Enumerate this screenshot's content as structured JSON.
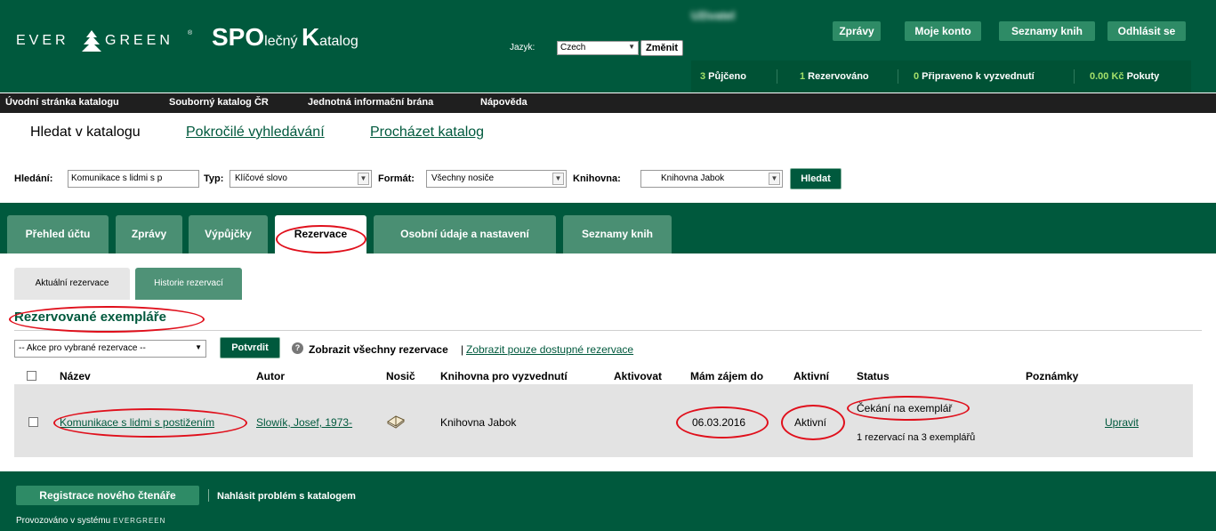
{
  "header": {
    "logo": {
      "left": "EVER",
      "right": "GREEN",
      "tm": "®"
    },
    "title_big1": "SPO",
    "title_small1": "lečný ",
    "title_big2": "K",
    "title_small2": "atalog",
    "language_label": "Jazyk:",
    "language_value": "Czech",
    "language_button": "Změnit",
    "user_name": "Uživatel",
    "top_buttons": [
      "Zprávy",
      "Moje konto",
      "Seznamy knih",
      "Odhlásit se"
    ],
    "status": {
      "borrowed_num": "3",
      "borrowed_label": " Půjčeno",
      "holds_num": "1",
      "holds_label": " Rezervováno",
      "ready_num": "0",
      "ready_label": " Připraveno k vyzvednutí",
      "fines_num": "0.00 Kč",
      "fines_label": " Pokuty"
    }
  },
  "topnav": [
    "Úvodní stránka katalogu",
    "Souborný katalog ČR",
    "Jednotná informační brána",
    "Nápověda"
  ],
  "search_tabs": [
    "Hledat v katalogu",
    "Pokročilé vyhledávání",
    "Procházet katalog"
  ],
  "search": {
    "query_label": "Hledání:",
    "query_value": "Komunikace s lidmi s p",
    "type_label": "Typ:",
    "type_value": "Klíčové slovo",
    "format_label": "Formát:",
    "format_value": "Všechny nosiče",
    "library_label": "Knihovna:",
    "library_value": "Knihovna Jabok",
    "submit": "Hledat"
  },
  "main_tabs": [
    "Přehled účtu",
    "Zprávy",
    "Výpůjčky",
    "Rezervace",
    "Osobní údaje a nastavení",
    "Seznamy knih"
  ],
  "sub_tabs": [
    "Aktuální rezervace",
    "Historie rezervací"
  ],
  "section_title": "Rezervované exempláře",
  "actions": {
    "select_value": "-- Akce pro vybrané rezervace --",
    "confirm": "Potvrdit",
    "help": "?",
    "show_all": "Zobrazit všechny rezervace",
    "separator": "|",
    "show_available": "Zobrazit pouze dostupné rezervace"
  },
  "table": {
    "headers": [
      "Název",
      "Autor",
      "Nosič",
      "Knihovna pro vyzvednutí",
      "Aktivovat",
      "Mám zájem do",
      "Aktivní",
      "Status",
      "Poznámky"
    ],
    "rows": [
      {
        "title": "Komunikace s lidmi s postižením",
        "author": "Slowík, Josef, 1973-",
        "pickup_library": "Knihovna Jabok",
        "activate": "",
        "expire": "06.03.2016",
        "active": "Aktivní",
        "status": "Čekání na exemplář",
        "status_detail": "1 rezervací na 3 exemplářů",
        "notes": "",
        "edit": "Upravit"
      }
    ]
  },
  "footer": {
    "register": "Registrace nového čtenáře",
    "report": "Nahlásit problém s katalogem",
    "powered_by": "Provozováno v systému",
    "powered_logo": "EVERGREEN"
  },
  "colors": {
    "brand_green": "#00593d",
    "tab_green": "#4a8f73",
    "button_green": "#2e8b66",
    "highlight_number": "#a3e06a",
    "annotation_red": "#e0101c"
  }
}
